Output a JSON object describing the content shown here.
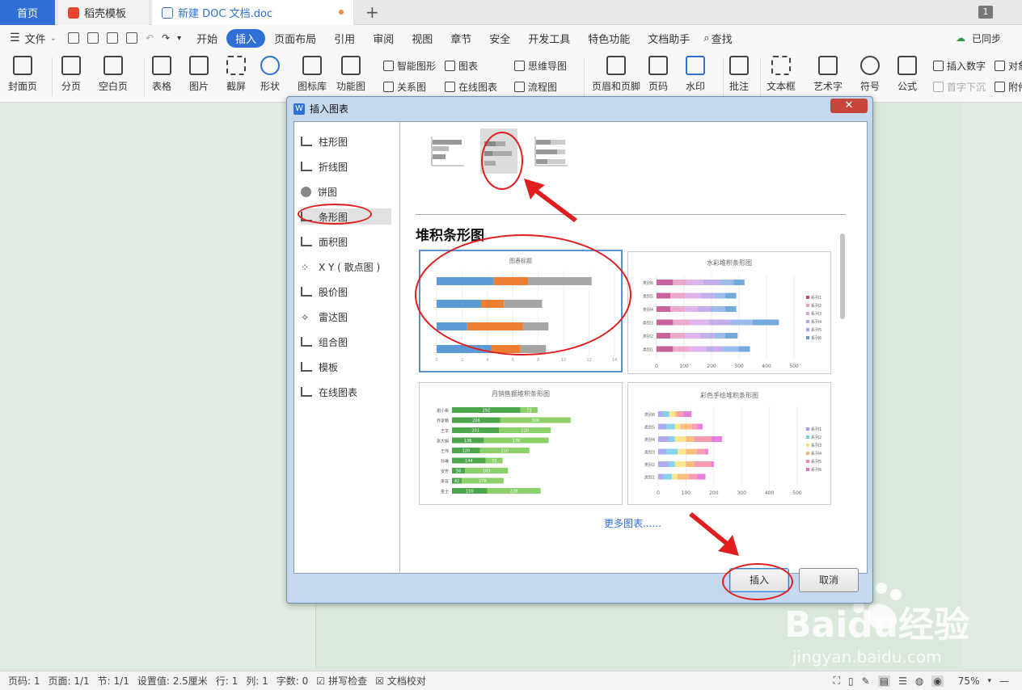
{
  "tabs": {
    "home": "首页",
    "template": "稻壳模板",
    "doc": "新建 DOC 文档.doc",
    "window_count": "1"
  },
  "menu": {
    "file": "文件",
    "items": [
      "开始",
      "插入",
      "页面布局",
      "引用",
      "审阅",
      "视图",
      "章节",
      "安全",
      "开发工具",
      "特色功能",
      "文档助手"
    ],
    "active": "插入",
    "search": "查找",
    "sync": "已同步"
  },
  "ribbon": {
    "big": [
      "封面页",
      "分页",
      "空白页",
      "表格",
      "图片",
      "截屏",
      "形状",
      "图标库",
      "功能图",
      "页眉和页脚",
      "页码",
      "水印",
      "批注",
      "文本框",
      "艺术字",
      "符号",
      "公式"
    ],
    "small": [
      "智能图形",
      "图表",
      "思维导图",
      "关系图",
      "在线图表",
      "流程图",
      "插入数字",
      "首字下沉",
      "对象",
      "附件"
    ]
  },
  "dialog": {
    "title": "插入图表",
    "categories": [
      "柱形图",
      "折线图",
      "饼图",
      "条形图",
      "面积图",
      "X Y ( 散点图 )",
      "股价图",
      "雷达图",
      "组合图",
      "模板",
      "在线图表"
    ],
    "selected_category": "条形图",
    "selected_subtype_title": "堆积条形图",
    "thumbnails": [
      {
        "title": "图表标题",
        "axis": [
          "0",
          "2",
          "4",
          "6",
          "8",
          "10",
          "12",
          "14"
        ]
      },
      {
        "title": "水彩堆积条形图",
        "axis": [
          "0",
          "100",
          "200",
          "300",
          "400",
          "500"
        ],
        "series": [
          "系列1",
          "系列2",
          "系列3",
          "系列4",
          "系列5",
          "系列6"
        ],
        "cats": [
          "类别6",
          "类别5",
          "类别4",
          "类别3",
          "类别2",
          "类别1"
        ]
      },
      {
        "title": "月销售额堆积条形图",
        "rows": [
          [
            "谢小希",
            "292",
            "73"
          ],
          [
            "乔家畅",
            "206",
            "300"
          ],
          [
            "王羊",
            "201",
            "220"
          ],
          [
            "张大娟",
            "136",
            "276"
          ],
          [
            "王伟",
            "120",
            "210"
          ],
          [
            "孙琳",
            "144",
            "72"
          ],
          [
            "安芳",
            "56",
            "183"
          ],
          [
            "李芳",
            "42",
            "178"
          ],
          [
            "金士",
            "150",
            "228"
          ]
        ]
      },
      {
        "title": "彩色手绘堆积条形图",
        "axis": [
          "0",
          "100",
          "200",
          "300",
          "400",
          "500"
        ],
        "series": [
          "系列1",
          "系列2",
          "系列3",
          "系列4",
          "系列5",
          "系列6"
        ],
        "cats": [
          "类别6",
          "类别5",
          "类别4",
          "类别3",
          "类别2",
          "类别1"
        ]
      }
    ],
    "more": "更多图表......",
    "insert": "插入",
    "cancel": "取消"
  },
  "status": {
    "page_code": "页码: 1",
    "pages": "页面: 1/1",
    "section": "节: 1/1",
    "setting": "设置值: 2.5厘米",
    "row": "行: 1",
    "col": "列: 1",
    "words": "字数: 0",
    "spell": "拼写检查",
    "proof": "文档校对",
    "zoom": "75%"
  },
  "watermark": {
    "brand": "Baidu经验",
    "url": "jingyan.baidu.com"
  }
}
